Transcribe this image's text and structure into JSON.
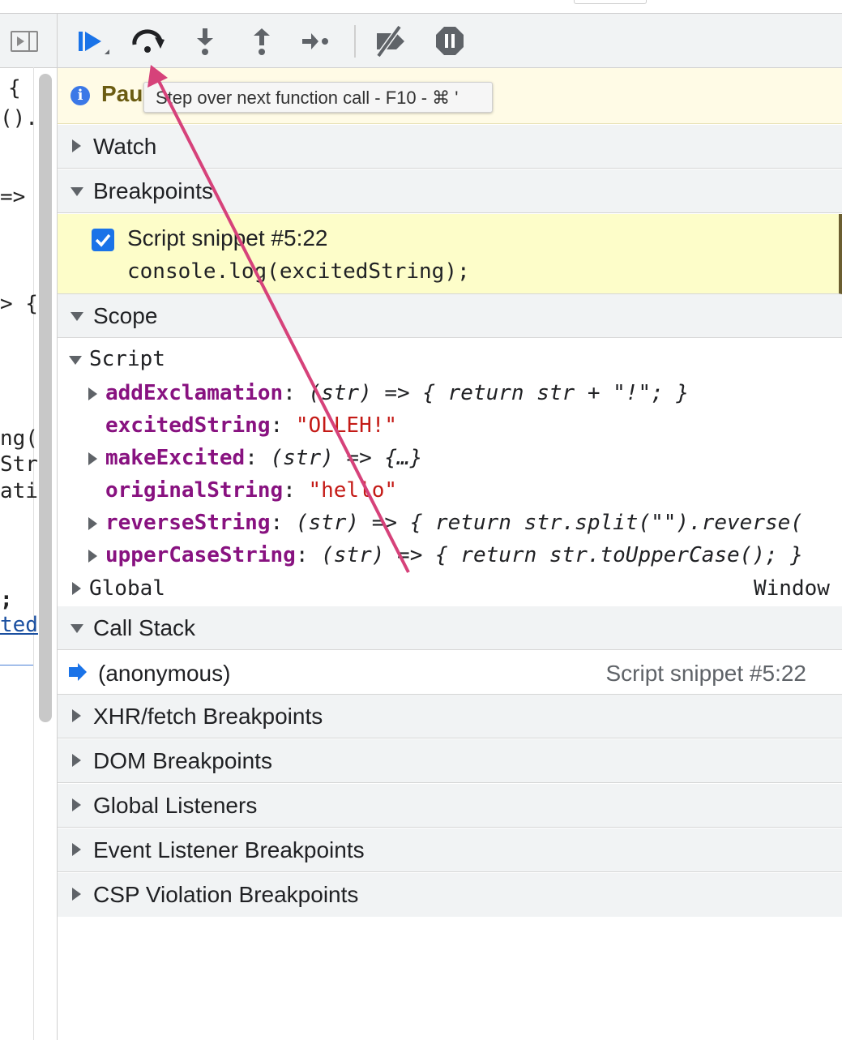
{
  "toolbar": {
    "buttons": [
      {
        "name": "resume",
        "icon": "resume-icon"
      },
      {
        "name": "step-over",
        "icon": "step-over-icon"
      },
      {
        "name": "step-into",
        "icon": "step-into-icon"
      },
      {
        "name": "step-out",
        "icon": "step-out-icon"
      },
      {
        "name": "step",
        "icon": "step-icon"
      },
      {
        "name": "deactivate-breakpoints",
        "icon": "deactivate-breakpoints-icon"
      },
      {
        "name": "pause-on-exceptions",
        "icon": "pause-icon"
      }
    ]
  },
  "banner": {
    "text": "Pau",
    "icon": "info-icon"
  },
  "tooltip": {
    "text": "Step over next function call - F10 - ⌘ '"
  },
  "sections": {
    "watch": "Watch",
    "breakpoints": "Breakpoints",
    "scope": "Scope",
    "call_stack": "Call Stack",
    "xhr": "XHR/fetch Breakpoints",
    "dom": "DOM Breakpoints",
    "global_listeners": "Global Listeners",
    "event_listener": "Event Listener Breakpoints",
    "csp": "CSP Violation Breakpoints"
  },
  "breakpoint": {
    "location": "Script snippet #5:22",
    "code": "console.log(excitedString);",
    "checked": true
  },
  "scope": {
    "script_label": "Script",
    "global_label": "Global",
    "global_value": "Window",
    "vars": [
      {
        "key": "addExclamation",
        "value": "(str) => { return str + \"!\"; }",
        "kind": "fn",
        "expandable": true
      },
      {
        "key": "excitedString",
        "value": "\"OLLEH!\"",
        "kind": "str",
        "expandable": false
      },
      {
        "key": "makeExcited",
        "value": "(str) => {…}",
        "kind": "fn",
        "expandable": true
      },
      {
        "key": "originalString",
        "value": "\"hello\"",
        "kind": "str",
        "expandable": false
      },
      {
        "key": "reverseString",
        "value": "(str) => { return str.split(\"\").reverse(",
        "kind": "fn",
        "expandable": true
      },
      {
        "key": "upperCaseString",
        "value": "(str) => { return str.toUpperCase(); }",
        "kind": "fn",
        "expandable": true
      }
    ]
  },
  "call_stack": {
    "frames": [
      {
        "name": "(anonymous)",
        "location": "Script snippet #5:22"
      }
    ]
  },
  "left_code": {
    "fragments": [
      "{",
      "().",
      "=>",
      "> {",
      "ng(",
      "Str",
      "ati",
      ";",
      "ted"
    ]
  },
  "colors": {
    "accent": "#1a73e8",
    "annotation_arrow": "#d6427a",
    "paused_banner": "#fffbe6",
    "breakpoint_highlight": "#fdfdc9",
    "scope_key": "#881280",
    "scope_string": "#c41a16"
  }
}
